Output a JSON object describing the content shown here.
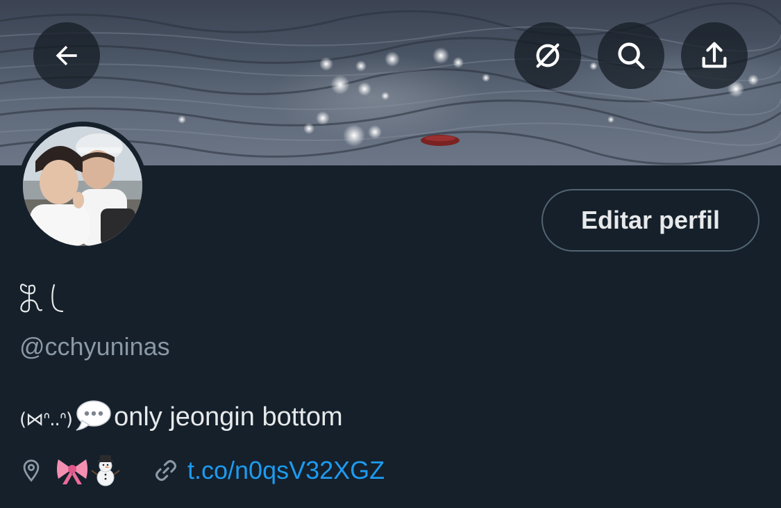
{
  "profile": {
    "display_name": "ⓗꞁ",
    "handle": "@cchyuninas",
    "bio_kaomoji": "(⋈ᐢ..ᐢ)",
    "bio_text": "only jeongin bottom",
    "location": "🎀⛄",
    "link": "t.co/n0qsV32XGZ"
  },
  "actions": {
    "edit_profile_label": "Editar perfil"
  },
  "icons": {
    "back": "arrow-left-icon",
    "hide_replies": "circle-slash-icon",
    "search": "search-icon",
    "share": "share-upload-icon",
    "location": "location-pin-icon",
    "link": "link-icon",
    "speech_bubble": "speech-bubble-emoji"
  },
  "colors": {
    "background": "#15202b",
    "link": "#1d9bf0",
    "muted_text": "#8b98a5",
    "button_border": "#536471"
  }
}
